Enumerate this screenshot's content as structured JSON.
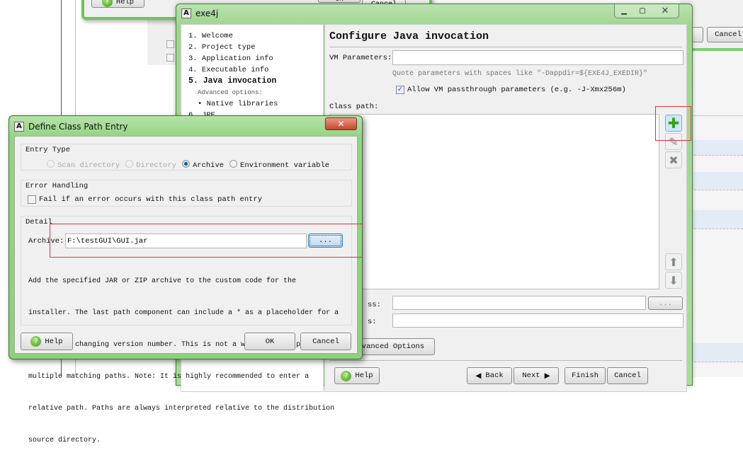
{
  "background_window": {
    "help_label": "Help",
    "ok_label": "OK",
    "cancel_label": "Cancel",
    "right_n_label": "n",
    "right_cancel_label": "Cancel"
  },
  "exe4j": {
    "title": "exe4j",
    "steps": [
      {
        "label": "1. Welcome"
      },
      {
        "label": "2. Project type"
      },
      {
        "label": "3. Application info"
      },
      {
        "label": "4. Executable info"
      },
      {
        "label": "5. Java invocation",
        "active": true
      },
      {
        "label": "Advanced options:"
      },
      {
        "label": "• Native libraries"
      },
      {
        "label": "6. JRE"
      }
    ],
    "heading": "Configure Java invocation",
    "vm_params_label": "VM Parameters:",
    "vm_params_value": "",
    "vm_hint": "Quote parameters with spaces like \"-Dappdir=${EXE4J_EXEDIR}\"",
    "allow_passthrough_label": "Allow VM passthrough parameters (e.g. -J-Xmx256m)",
    "allow_passthrough_checked": true,
    "class_path_label": "Class path:",
    "main_class_label_partial": "ss:",
    "args_label_partial": "s:",
    "browse_label": "...",
    "advanced_options_label_partial": "vanced Options",
    "help_label": "Help",
    "back_label": "Back",
    "next_label": "Next",
    "finish_label": "Finish",
    "cancel_label": "Cancel",
    "icons": [
      "add-icon",
      "edit-icon",
      "delete-icon",
      "arrow-up-icon",
      "arrow-down-icon"
    ],
    "accent_color": "#3aa32a"
  },
  "dialog": {
    "title": "Define Class Path Entry",
    "entry_type_label": "Entry Type",
    "entry_types": [
      {
        "label": "Scan directory",
        "selected": false,
        "disabled": true
      },
      {
        "label": "Directory",
        "selected": false,
        "disabled": true
      },
      {
        "label": "Archive",
        "selected": true,
        "disabled": false
      },
      {
        "label": "Environment variable",
        "selected": false,
        "disabled": false
      }
    ],
    "error_handling_label": "Error Handling",
    "fail_checkbox_label": "Fail if an error occurs with this class path entry",
    "fail_checked": false,
    "detail_label": "Detail",
    "archive_label": "Archive:",
    "archive_value": "F:\\testGUI\\GUI.jar",
    "browse_label": "...",
    "description": [
      "Add the specified JAR or ZIP archive to the custom code for the",
      "installer. The last path component can include a * as a placeholder for a",
      "frequently changing version number. This is not a wildcard for processing",
      "multiple matching paths. Note: It is highly recommended to enter a",
      "relative path. Paths are always interpreted relative to the distribution",
      "source directory."
    ],
    "help_label": "Help",
    "ok_label": "OK",
    "cancel_label": "Cancel"
  }
}
